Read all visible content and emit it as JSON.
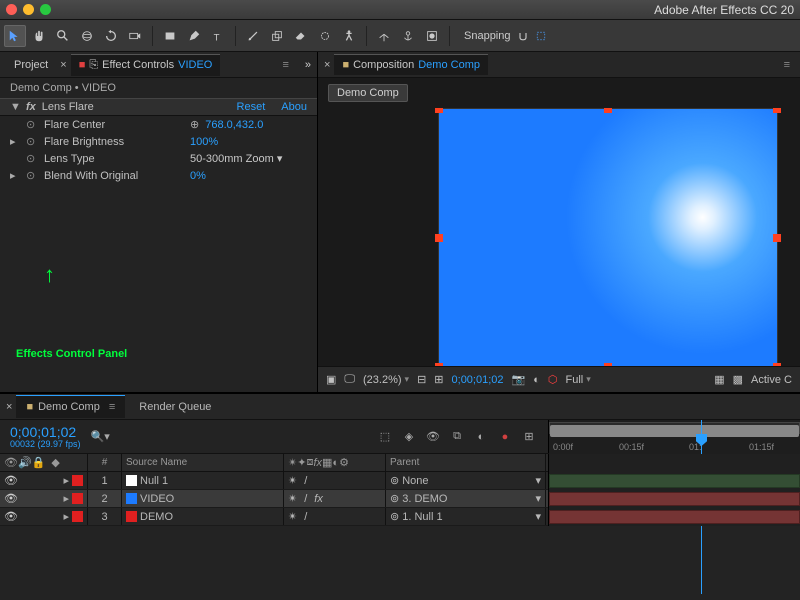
{
  "app": {
    "title": "Adobe After Effects CC 20"
  },
  "toolbar": {
    "snapping_label": "Snapping"
  },
  "panels": {
    "project_tab": "Project",
    "effect_controls_label": "Effect Controls",
    "effect_controls_target": "VIDEO",
    "composition_label": "Composition",
    "composition_target": "Demo Comp"
  },
  "effect_controls": {
    "breadcrumb": "Demo Comp • VIDEO",
    "effect_name": "Lens Flare",
    "reset": "Reset",
    "about": "Abou",
    "params": [
      {
        "label": "Flare Center",
        "value": "768.0,432.0",
        "has_crosshair": true
      },
      {
        "label": "Flare Brightness",
        "value": "100%"
      },
      {
        "label": "Lens Type",
        "value": "50-300mm Zoom",
        "dropdown": true
      },
      {
        "label": "Blend With Original",
        "value": "0%"
      }
    ]
  },
  "annotation": {
    "text": "Effects Control Panel"
  },
  "viewer": {
    "breadcrumb": "Demo Comp",
    "zoom": "(23.2%)",
    "timecode": "0;00;01;02",
    "resolution": "Full",
    "view_mode": "Active C"
  },
  "timeline": {
    "tab_active": "Demo Comp",
    "tab_render": "Render Queue",
    "timecode": "0;00;01;02",
    "frame_info": "00032 (29.97 fps)",
    "col_num": "#",
    "col_source": "Source Name",
    "col_parent": "Parent",
    "ticks": [
      "0:00f",
      "00:15f",
      "01:",
      "01:15f"
    ],
    "layers": [
      {
        "n": "1",
        "name": "Null 1",
        "color": "#ffffff",
        "parent": "None"
      },
      {
        "n": "2",
        "name": "VIDEO",
        "color": "#1d7bff",
        "parent": "3. DEMO",
        "selected": true,
        "fx": true
      },
      {
        "n": "3",
        "name": "DEMO",
        "color": "#e02020",
        "parent": "1. Null 1"
      }
    ]
  }
}
